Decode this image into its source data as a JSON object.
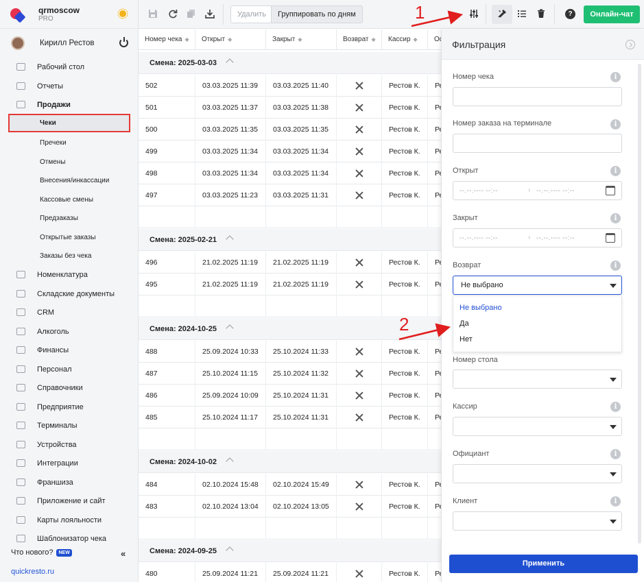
{
  "brand": {
    "name": "qrmoscow",
    "plan": "PRO"
  },
  "user": {
    "name": "Кирилл Рестов"
  },
  "sidebar": {
    "items": [
      {
        "label": "Рабочий стол"
      },
      {
        "label": "Отчеты"
      },
      {
        "label": "Продажи"
      },
      {
        "label": "Чеки"
      },
      {
        "label": "Пречеки"
      },
      {
        "label": "Отмены"
      },
      {
        "label": "Внесения/инкассации"
      },
      {
        "label": "Кассовые смены"
      },
      {
        "label": "Предзаказы"
      },
      {
        "label": "Открытые заказы"
      },
      {
        "label": "Заказы без чека"
      },
      {
        "label": "Номенклатура"
      },
      {
        "label": "Складские документы"
      },
      {
        "label": "CRM"
      },
      {
        "label": "Алкоголь"
      },
      {
        "label": "Финансы"
      },
      {
        "label": "Персонал"
      },
      {
        "label": "Справочники"
      },
      {
        "label": "Предприятие"
      },
      {
        "label": "Терминалы"
      },
      {
        "label": "Устройства"
      },
      {
        "label": "Интеграции"
      },
      {
        "label": "Франшиза"
      },
      {
        "label": "Приложение и сайт"
      },
      {
        "label": "Карты лояльности"
      },
      {
        "label": "Шаблонизатор чека"
      }
    ],
    "whats_new": "Что нового?",
    "new_badge": "NEW",
    "site": "quickresto.ru"
  },
  "toolbar": {
    "delete_label": "Удалить",
    "group_label": "Группировать по дням",
    "chat_label": "Онлайн-чат"
  },
  "table": {
    "headers": [
      "Номер чека",
      "Открыт",
      "Закрыт",
      "Возврат",
      "Кассир",
      "Оф"
    ],
    "groups": [
      {
        "label": "Смена: 2025-03-03",
        "rows": [
          {
            "num": "502",
            "open": "03.03.2025 11:39",
            "close": "03.03.2025 11:40",
            "cashier": "Рестов К.",
            "w": "Ре"
          },
          {
            "num": "501",
            "open": "03.03.2025 11:37",
            "close": "03.03.2025 11:38",
            "cashier": "Рестов К.",
            "w": "Ре"
          },
          {
            "num": "500",
            "open": "03.03.2025 11:35",
            "close": "03.03.2025 11:35",
            "cashier": "Рестов К.",
            "w": "Ре"
          },
          {
            "num": "499",
            "open": "03.03.2025 11:34",
            "close": "03.03.2025 11:34",
            "cashier": "Рестов К.",
            "w": "Ре"
          },
          {
            "num": "498",
            "open": "03.03.2025 11:34",
            "close": "03.03.2025 11:34",
            "cashier": "Рестов К.",
            "w": "Ре"
          },
          {
            "num": "497",
            "open": "03.03.2025 11:23",
            "close": "03.03.2025 11:31",
            "cashier": "Рестов К.",
            "w": "Ре"
          }
        ]
      },
      {
        "label": "Смена: 2025-02-21",
        "rows": [
          {
            "num": "496",
            "open": "21.02.2025 11:19",
            "close": "21.02.2025 11:19",
            "cashier": "Рестов К.",
            "w": "Ре"
          },
          {
            "num": "495",
            "open": "21.02.2025 11:19",
            "close": "21.02.2025 11:19",
            "cashier": "Рестов К.",
            "w": "Ре"
          }
        ]
      },
      {
        "label": "Смена: 2024-10-25",
        "rows": [
          {
            "num": "488",
            "open": "25.09.2024 10:33",
            "close": "25.10.2024 11:33",
            "cashier": "Рестов К.",
            "w": "Ре"
          },
          {
            "num": "487",
            "open": "25.10.2024 11:15",
            "close": "25.10.2024 11:32",
            "cashier": "Рестов К.",
            "w": "Ре"
          },
          {
            "num": "486",
            "open": "25.09.2024 10:09",
            "close": "25.10.2024 11:31",
            "cashier": "Рестов К.",
            "w": "Ре"
          },
          {
            "num": "485",
            "open": "25.10.2024 11:17",
            "close": "25.10.2024 11:31",
            "cashier": "Рестов К.",
            "w": "Ре"
          }
        ]
      },
      {
        "label": "Смена: 2024-10-02",
        "rows": [
          {
            "num": "484",
            "open": "02.10.2024 15:48",
            "close": "02.10.2024 15:49",
            "cashier": "Рестов К.",
            "w": "Ре"
          },
          {
            "num": "483",
            "open": "02.10.2024 13:04",
            "close": "02.10.2024 13:05",
            "cashier": "Рестов К.",
            "w": "Ре"
          }
        ]
      },
      {
        "label": "Смена: 2024-09-25",
        "rows": [
          {
            "num": "480",
            "open": "25.09.2024 11:21",
            "close": "25.09.2024 11:21",
            "cashier": "Рестов К.",
            "w": "Ре"
          }
        ]
      }
    ]
  },
  "filter": {
    "title": "Фильтрация",
    "fields": {
      "receipt_no": "Номер чека",
      "terminal_order": "Номер заказа на терминале",
      "opened": "Открыт",
      "closed": "Закрыт",
      "refund": "Возврат",
      "table_no": "Номер стола",
      "cashier": "Кассир",
      "waiter": "Официант",
      "client": "Клиент"
    },
    "date_placeholder": "--.--.---- --:--",
    "refund_value": "Не выбрано",
    "refund_options": [
      "Не выбрано",
      "Да",
      "Нет"
    ],
    "apply_label": "Применить"
  },
  "annotations": {
    "step1": "1",
    "step2": "2",
    "color": "#e01e1e"
  }
}
